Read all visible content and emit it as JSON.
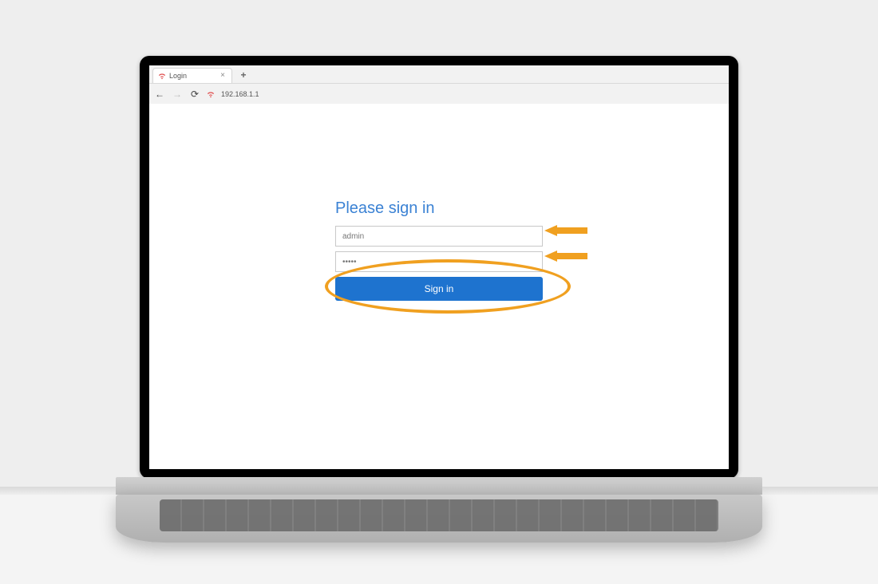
{
  "browser": {
    "tab_title": "Login",
    "url": "192.168.1.1",
    "close_glyph": "×",
    "newtab_glyph": "+",
    "back_glyph": "←",
    "forward_glyph": "→",
    "reload_glyph": "⟳"
  },
  "login": {
    "heading": "Please sign in",
    "username_value": "admin",
    "password_value": "•••••",
    "signin_label": "Sign in"
  },
  "annotation": {
    "arrow1_target": "username-field",
    "arrow2_target": "password-field",
    "ellipse_target": "signin-button",
    "color": "#f0a020"
  }
}
